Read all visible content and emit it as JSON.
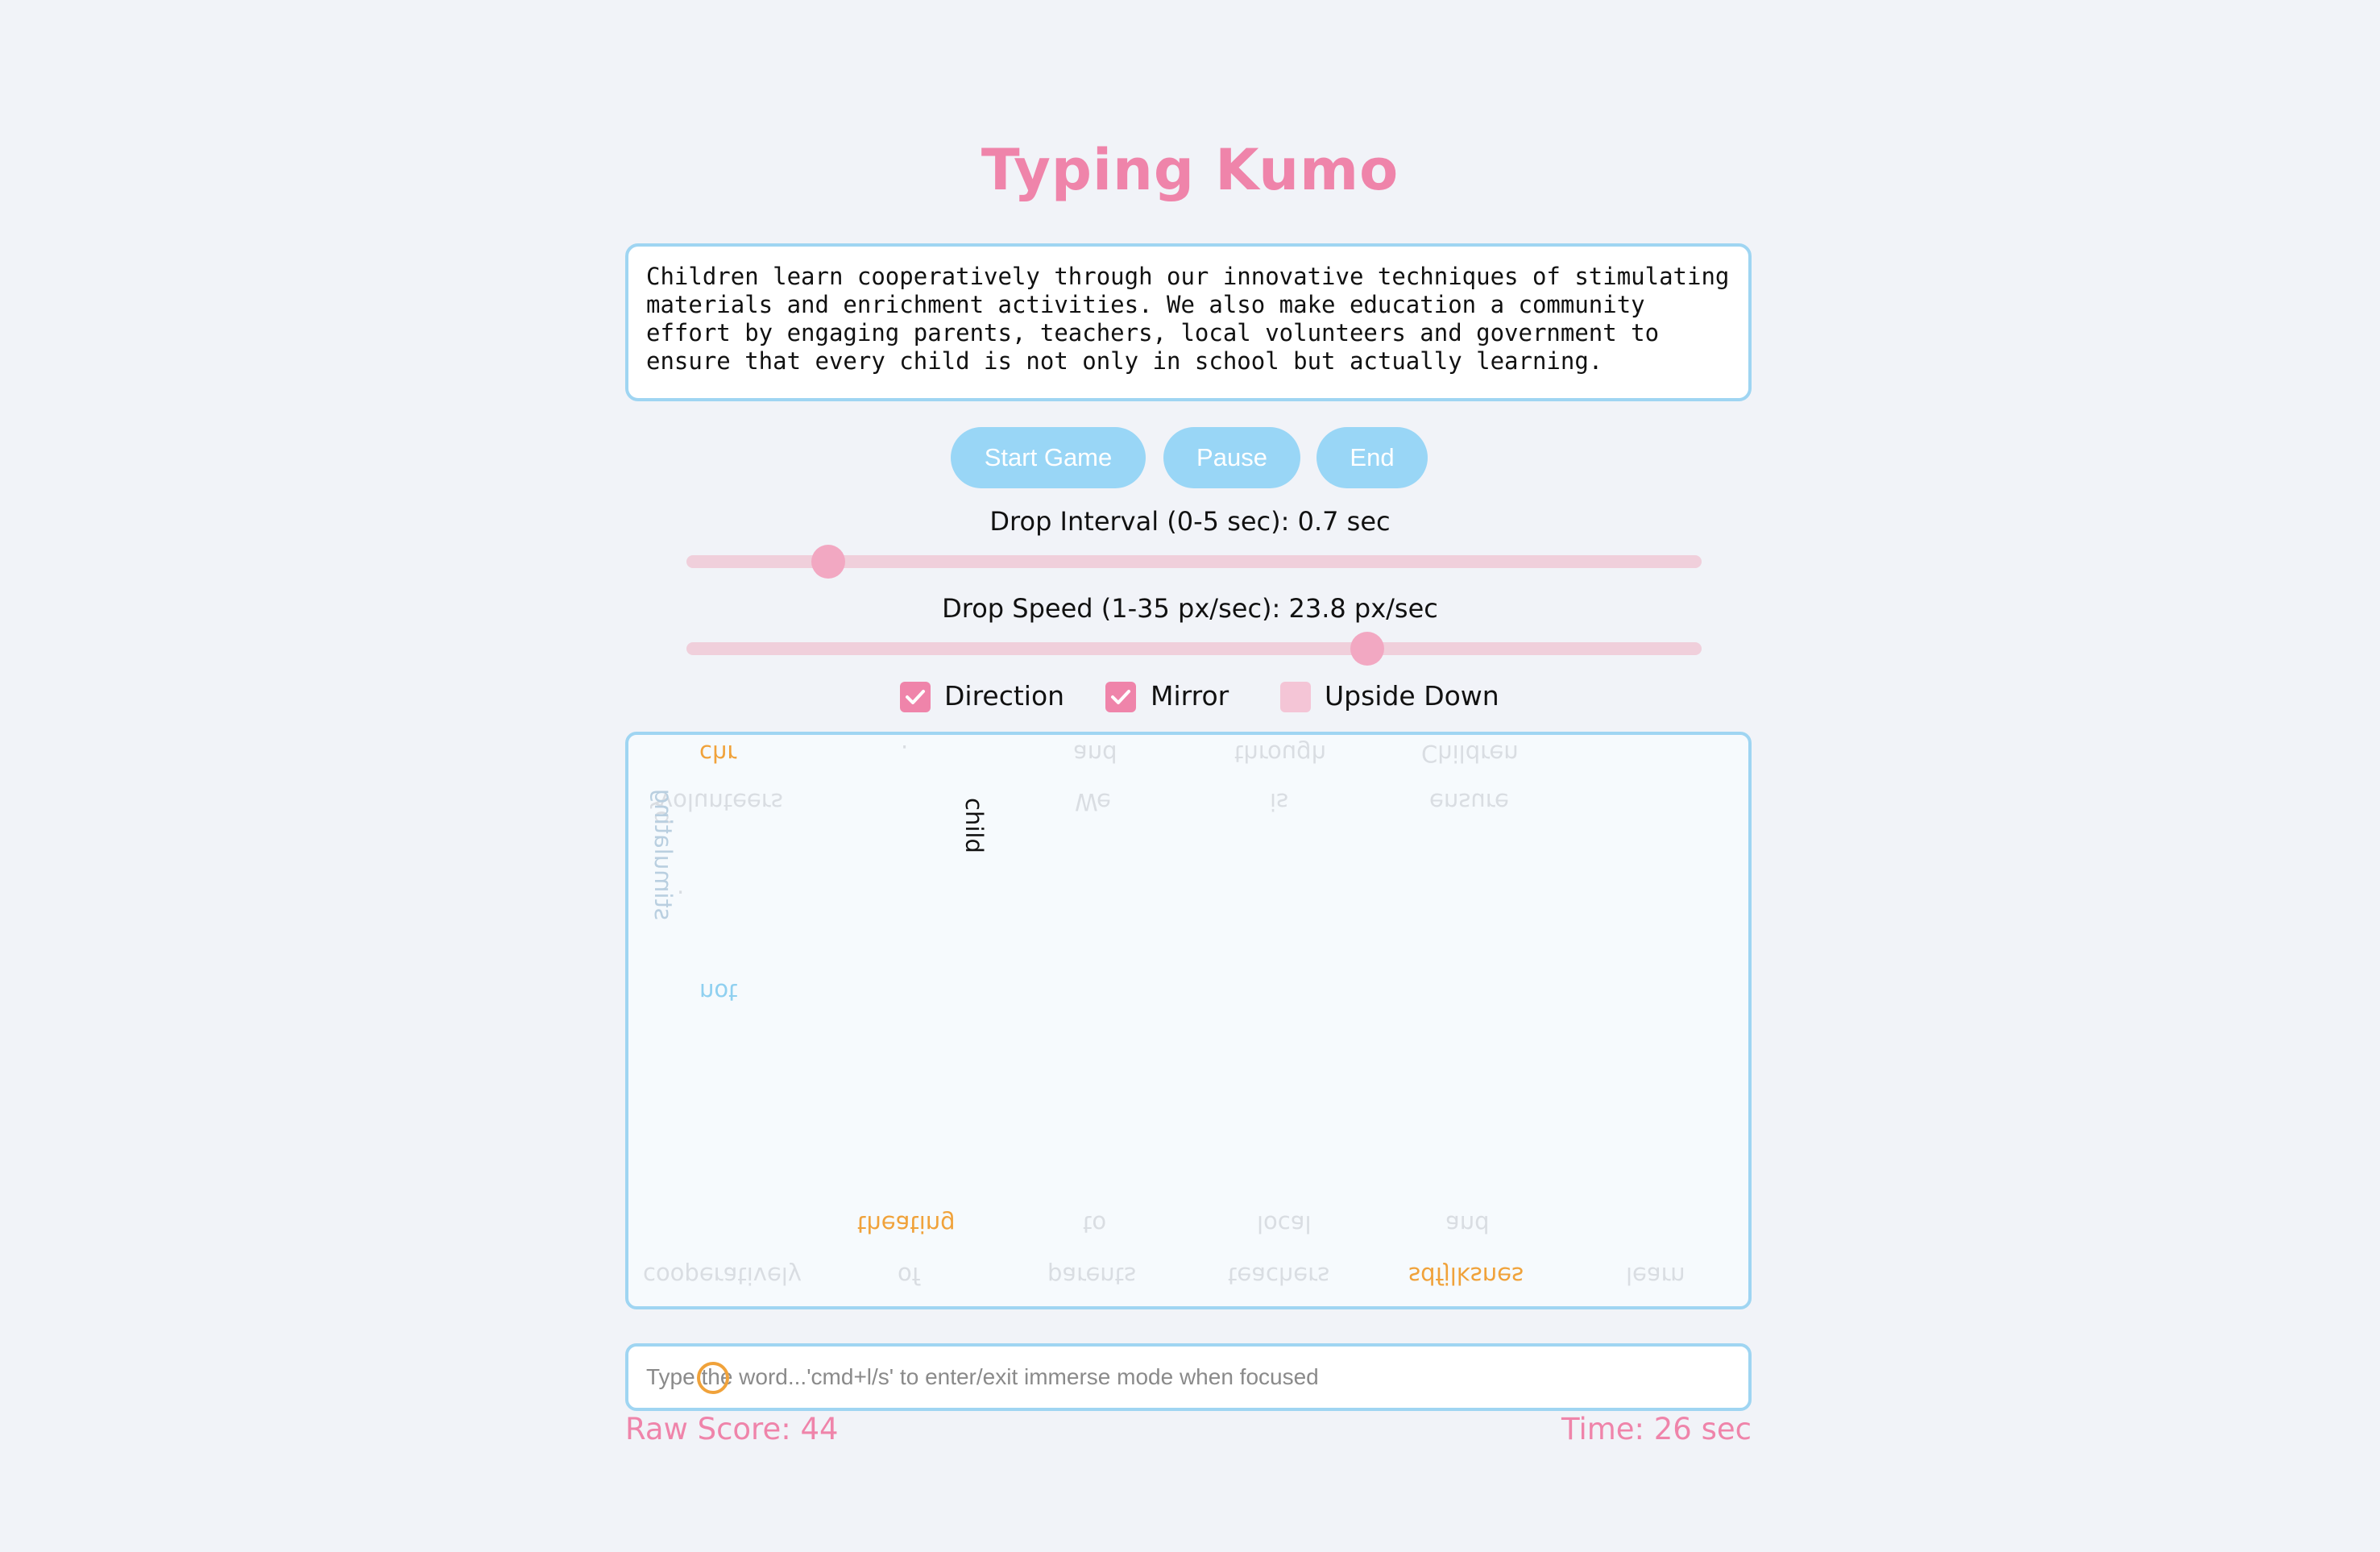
{
  "app": {
    "title": "Typing Kumo"
  },
  "source_text": "Children learn cooperatively through our innovative techniques of stimulating materials and enrichment activities. We also make education a community effort by engaging parents, teachers, local volunteers and government to ensure that every child is not only in school but actually learning.",
  "buttons": {
    "start": "Start Game",
    "pause": "Pause",
    "end": "End"
  },
  "sliders": {
    "interval": {
      "label": "Drop Interval (0-5 sec): 0.7 sec",
      "value": 0.7,
      "min": 0,
      "max": 5
    },
    "speed": {
      "label": "Drop Speed (1-35 px/sec): 23.8 px/sec",
      "value": 23.8,
      "min": 1,
      "max": 35
    }
  },
  "options": [
    {
      "label": "Direction",
      "checked": true
    },
    {
      "label": "Mirror",
      "checked": true
    },
    {
      "label": "Upside Down",
      "checked": false
    }
  ],
  "arena_words": {
    "top_row": [
      "chr",
      ".",
      "and",
      "through",
      "Children"
    ],
    "second_row": [
      "volunteers",
      "We",
      "is",
      "ensure"
    ],
    "falling": "child",
    "side_words": [
      "by",
      ".",
      "stimulating",
      "not"
    ],
    "lower_row": [
      "theating",
      "to",
      "local",
      "and"
    ],
    "bottom_row": [
      "cooperatively",
      "of",
      "parents",
      "teachers",
      "sdfjlksnes",
      "learn"
    ]
  },
  "input": {
    "placeholder": "Type the word...'cmd+l/s' to enter/exit immerse mode when focused",
    "value": ""
  },
  "status": {
    "score": "Raw Score: 44",
    "time": "Time: 26 sec"
  },
  "colors": {
    "accent": "#ef84aa",
    "border": "#9fd5f2",
    "button": "#99d6f6",
    "hit": "#f0a23a"
  }
}
